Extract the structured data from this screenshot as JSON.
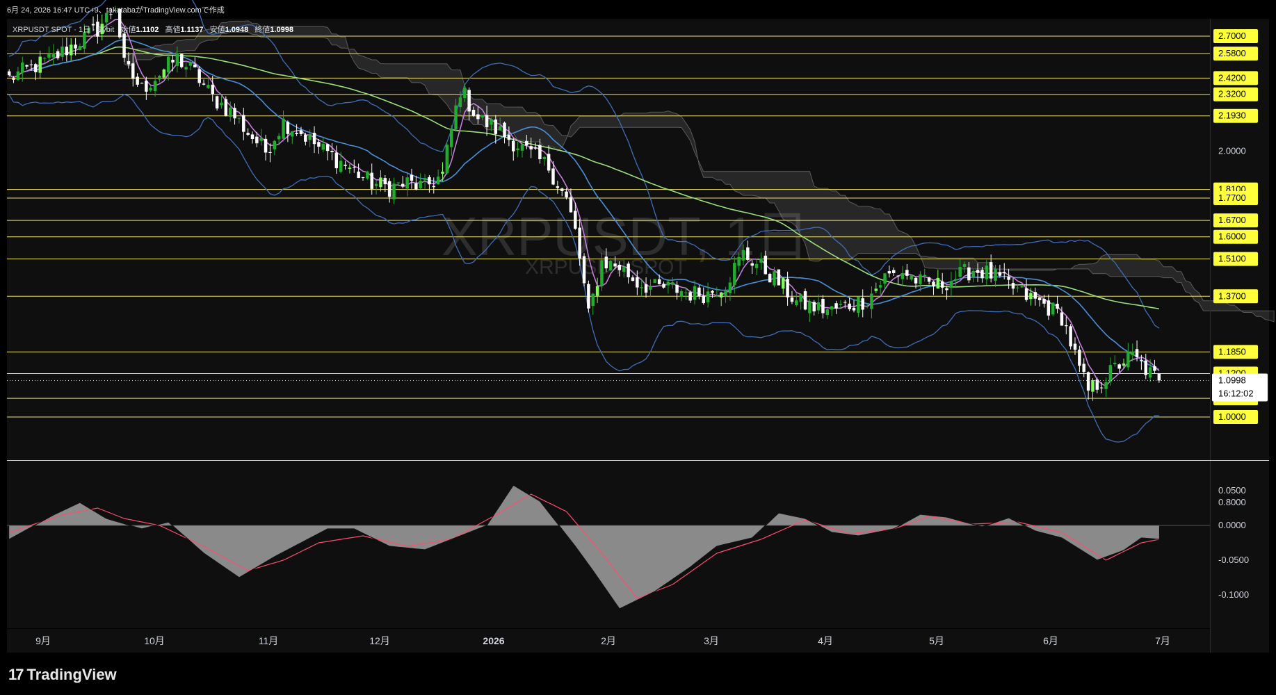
{
  "header": {
    "created_line": "6月 24, 2026 16:47 UTC+9、takatabaがTradingView.comで作成"
  },
  "legend": {
    "symbol_line": "XRPUSDT SPOT · 1日 · Bybit",
    "open_label": "始値",
    "open": "1.1102",
    "high_label": "高値",
    "high": "1.1137",
    "low_label": "安値",
    "low": "1.0948",
    "close_label": "終値",
    "close": "1.0998"
  },
  "watermark": {
    "big": "XRPUSDT, 1日",
    "small": "XRPUSDT SPOT"
  },
  "branding": {
    "logo_mark": "17",
    "logo_text": "TradingView"
  },
  "colors": {
    "bull": "#22ab2c",
    "bull_bright": "#7fff5c",
    "bear": "#ffffff",
    "sma_fast": "#c77ddc",
    "sma_mid": "#4a90d9",
    "sma_slow": "#9be07a",
    "bollinger": "#3f6fb8",
    "hline": "#f2e36b",
    "label_bg": "#ffff3b",
    "macd_line": "#ff4d6d",
    "macd_hist": "#8a8a8a"
  },
  "chart_data": [
    {
      "type": "candlestick",
      "title": "XRPUSDT SPOT · 1日 · Bybit",
      "y_scale": "log",
      "ylim": [
        0.8,
        2.8
      ],
      "x_labels": [
        "9月",
        "10月",
        "11月",
        "12月",
        "2026",
        "2月",
        "3月",
        "4月",
        "5月",
        "6月",
        "7月"
      ],
      "y_ticks": [
        "2.0000",
        "0.8000"
      ],
      "horizontal_levels": [
        "2.7000",
        "2.5800",
        "2.4200",
        "2.3200",
        "2.1930",
        "1.8100",
        "1.7700",
        "1.6700",
        "1.6000",
        "1.5100",
        "1.3700",
        "1.1850",
        "1.1200",
        "1.0500",
        "1.0000"
      ],
      "last_price": "1.0998",
      "countdown": "16:12:02",
      "series": [
        {
          "name": "close",
          "points": [
            [
              0,
              2.42
            ],
            [
              10,
              2.55
            ],
            [
              20,
              2.75
            ],
            [
              24,
              2.92
            ],
            [
              26,
              2.5
            ],
            [
              30,
              2.35
            ],
            [
              34,
              2.45
            ],
            [
              38,
              2.55
            ],
            [
              42,
              2.45
            ],
            [
              46,
              2.3
            ],
            [
              50,
              2.22
            ],
            [
              54,
              2.1
            ],
            [
              58,
              2.0
            ],
            [
              62,
              2.16
            ],
            [
              66,
              2.1
            ],
            [
              70,
              2.02
            ],
            [
              74,
              1.96
            ],
            [
              78,
              1.9
            ],
            [
              82,
              1.84
            ],
            [
              86,
              1.82
            ],
            [
              90,
              1.84
            ],
            [
              94,
              1.82
            ],
            [
              98,
              1.88
            ],
            [
              102,
              2.35
            ],
            [
              106,
              2.18
            ],
            [
              110,
              2.12
            ],
            [
              114,
              2.05
            ],
            [
              118,
              1.98
            ],
            [
              122,
              1.92
            ],
            [
              126,
              1.76
            ],
            [
              128,
              1.62
            ],
            [
              131,
              1.3
            ],
            [
              134,
              1.5
            ],
            [
              138,
              1.48
            ],
            [
              142,
              1.42
            ],
            [
              146,
              1.4
            ],
            [
              150,
              1.4
            ],
            [
              154,
              1.38
            ],
            [
              158,
              1.38
            ],
            [
              162,
              1.42
            ],
            [
              166,
              1.53
            ],
            [
              170,
              1.48
            ],
            [
              174,
              1.42
            ],
            [
              178,
              1.35
            ],
            [
              182,
              1.33
            ],
            [
              186,
              1.32
            ],
            [
              190,
              1.34
            ],
            [
              194,
              1.36
            ],
            [
              198,
              1.44
            ],
            [
              202,
              1.46
            ],
            [
              206,
              1.42
            ],
            [
              210,
              1.41
            ],
            [
              214,
              1.44
            ],
            [
              218,
              1.47
            ],
            [
              222,
              1.45
            ],
            [
              226,
              1.41
            ],
            [
              230,
              1.37
            ],
            [
              234,
              1.34
            ],
            [
              238,
              1.3
            ],
            [
              242,
              1.13
            ],
            [
              244,
              1.07
            ],
            [
              248,
              1.11
            ],
            [
              252,
              1.16
            ],
            [
              254,
              1.17
            ],
            [
              258,
              1.12
            ],
            [
              260,
              1.1
            ]
          ]
        }
      ]
    },
    {
      "type": "line",
      "title": "",
      "ylim": [
        -0.12,
        0.07
      ],
      "y_ticks": [
        "0.0500",
        "0.0000",
        "-0.0500",
        "-0.1000"
      ],
      "series": [
        {
          "name": "histogram",
          "points": [
            [
              0,
              -0.02
            ],
            [
              10,
              0.015
            ],
            [
              16,
              0.033
            ],
            [
              22,
              0.01
            ],
            [
              30,
              -0.005
            ],
            [
              36,
              0.005
            ],
            [
              44,
              -0.04
            ],
            [
              52,
              -0.075
            ],
            [
              60,
              -0.045
            ],
            [
              66,
              -0.025
            ],
            [
              72,
              -0.005
            ],
            [
              78,
              -0.005
            ],
            [
              86,
              -0.03
            ],
            [
              94,
              -0.035
            ],
            [
              100,
              -0.02
            ],
            [
              108,
              0.0
            ],
            [
              114,
              0.058
            ],
            [
              120,
              0.035
            ],
            [
              128,
              -0.03
            ],
            [
              132,
              -0.065
            ],
            [
              138,
              -0.12
            ],
            [
              146,
              -0.095
            ],
            [
              154,
              -0.06
            ],
            [
              160,
              -0.03
            ],
            [
              168,
              -0.018
            ],
            [
              174,
              0.018
            ],
            [
              180,
              0.01
            ],
            [
              186,
              -0.01
            ],
            [
              192,
              -0.015
            ],
            [
              200,
              -0.005
            ],
            [
              206,
              0.016
            ],
            [
              212,
              0.012
            ],
            [
              220,
              -0.002
            ],
            [
              226,
              0.011
            ],
            [
              232,
              -0.008
            ],
            [
              238,
              -0.018
            ],
            [
              246,
              -0.05
            ],
            [
              252,
              -0.036
            ],
            [
              256,
              -0.018
            ],
            [
              260,
              -0.02
            ]
          ]
        },
        {
          "name": "signal",
          "points": [
            [
              0,
              -0.01
            ],
            [
              12,
              0.015
            ],
            [
              20,
              0.025
            ],
            [
              26,
              0.01
            ],
            [
              34,
              0.0
            ],
            [
              44,
              -0.03
            ],
            [
              54,
              -0.065
            ],
            [
              62,
              -0.05
            ],
            [
              70,
              -0.025
            ],
            [
              80,
              -0.015
            ],
            [
              90,
              -0.03
            ],
            [
              100,
              -0.02
            ],
            [
              110,
              0.015
            ],
            [
              118,
              0.045
            ],
            [
              126,
              0.02
            ],
            [
              134,
              -0.04
            ],
            [
              142,
              -0.105
            ],
            [
              150,
              -0.085
            ],
            [
              160,
              -0.04
            ],
            [
              170,
              -0.02
            ],
            [
              180,
              0.008
            ],
            [
              190,
              -0.012
            ],
            [
              200,
              -0.005
            ],
            [
              208,
              0.013
            ],
            [
              218,
              0.002
            ],
            [
              228,
              0.005
            ],
            [
              238,
              -0.01
            ],
            [
              248,
              -0.05
            ],
            [
              256,
              -0.025
            ],
            [
              260,
              -0.02
            ]
          ]
        }
      ]
    }
  ]
}
